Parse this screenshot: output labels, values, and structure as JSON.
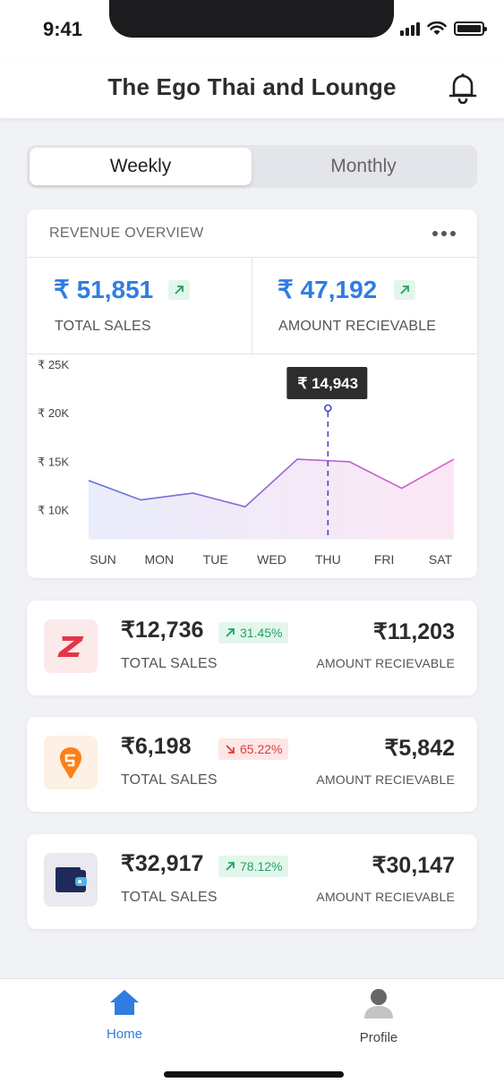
{
  "status": {
    "time": "9:41"
  },
  "header": {
    "title": "The Ego Thai and Lounge",
    "bell_icon": "bell-icon"
  },
  "toggle": {
    "options": [
      "Weekly",
      "Monthly"
    ],
    "selected": "Weekly"
  },
  "revenue": {
    "title": "REVENUE OVERVIEW",
    "more_icon": "more-horizontal-icon",
    "total_sales": {
      "value": "₹ 51,851",
      "label": "TOTAL SALES"
    },
    "amount_receivable": {
      "value": "₹ 47,192",
      "label": "AMOUNT RECIEVABLE"
    },
    "tooltip": "₹ 14,943"
  },
  "chart_data": {
    "type": "area",
    "categories": [
      "SUN",
      "MON",
      "TUE",
      "WED",
      "THU",
      "FRI",
      "SAT"
    ],
    "values": [
      13000,
      11000,
      11700,
      10300,
      15200,
      14943,
      12200,
      15200
    ],
    "x_positions_note": "",
    "ytick_labels": [
      "₹ 25K",
      "₹ 20K",
      "₹ 15K",
      "₹ 10K"
    ],
    "yticks": [
      25000,
      20000,
      15000,
      10000
    ],
    "ylim": [
      7000,
      26000
    ],
    "highlight_category": "THU",
    "highlight_value": 14943,
    "colors": {
      "start": "#5b6fe0",
      "end": "#e05cc4"
    }
  },
  "platforms": [
    {
      "logo_icon": "zomato-icon",
      "sales": "₹12,736",
      "change": "31.45%",
      "direction": "up",
      "sales_label": "TOTAL SALES",
      "receivable": "₹11,203",
      "receivable_label": "AMOUNT RECIEVABLE"
    },
    {
      "logo_icon": "swiggy-icon",
      "sales": "₹6,198",
      "change": "65.22%",
      "direction": "down",
      "sales_label": "TOTAL SALES",
      "receivable": "₹5,842",
      "receivable_label": "AMOUNT RECIEVABLE"
    },
    {
      "logo_icon": "wallet-icon",
      "sales": "₹32,917",
      "change": "78.12%",
      "direction": "up",
      "sales_label": "TOTAL SALES",
      "receivable": "₹30,147",
      "receivable_label": "AMOUNT RECIEVABLE"
    }
  ],
  "tabbar": {
    "items": [
      {
        "label": "Home",
        "icon": "home-icon",
        "active": true
      },
      {
        "label": "Profile",
        "icon": "profile-icon",
        "active": false
      }
    ],
    "active_color": "#2f7de1"
  }
}
